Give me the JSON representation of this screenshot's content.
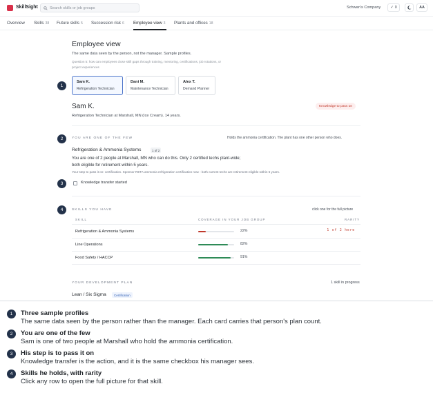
{
  "app": {
    "name": "SkillSight"
  },
  "search": {
    "placeholder": "Search skills or job groups"
  },
  "header": {
    "company": "Schwan's Company",
    "check_count": "0",
    "text_size_label": "AA"
  },
  "tabs": [
    {
      "label": "Overview",
      "count": ""
    },
    {
      "label": "Skills",
      "count": "38"
    },
    {
      "label": "Future skills",
      "count": "5"
    },
    {
      "label": "Succession risk",
      "count": "6"
    },
    {
      "label": "Employee view",
      "count": "3"
    },
    {
      "label": "Plants and offices",
      "count": "18"
    }
  ],
  "page": {
    "title": "Employee view",
    "subtitle": "The same data seen by the person, not the manager. Sample profiles.",
    "question_label": "Question 5:",
    "question_text": "how can employees close skill gaps through training, mentoring, certifications, job rotations, or project experiences"
  },
  "profiles": [
    {
      "name": "Sam K.",
      "role": "Refrigeration Technician",
      "selected": true
    },
    {
      "name": "Dani M.",
      "role": "Maintenance Technician",
      "selected": false
    },
    {
      "name": "Alex T.",
      "role": "Demand Planner",
      "selected": false
    }
  ],
  "profile": {
    "name": "Sam K.",
    "badge": "Knowledge to pass on",
    "meta": "Refrigeration Technician at Marshall, MN (Ice Cream). 14 years."
  },
  "section_one": {
    "kicker": "You are one of the few",
    "note": "Holds the ammonia certification. The plant has one other person who does.",
    "skill": "Refrigeration & Ammonia Systems",
    "skill_tag": "1 of 2",
    "paragraph": "You are one of 2 people at Marshall, MN who can do this. Only 2 certified techs plant-wide; both eligible for retirement within 5 years.",
    "detail": "Your step to pass it on: certification. Sponsor RETA ammonia refrigeration certification now - both current techs are retirement-eligible within 5 years.",
    "checkbox_label": "Knowledge transfer started",
    "checkbox_checked": false
  },
  "section_skills": {
    "kicker": "Skills you have",
    "hint": "click one for the full picture",
    "columns": {
      "skill": "Skill",
      "coverage": "Coverage in your job group",
      "rarity": "Rarity"
    },
    "rows": [
      {
        "skill": "Refrigeration & Ammonia Systems",
        "coverage_pct": 22,
        "coverage_label": "22%",
        "color": "#c0392b",
        "rarity": "1 of 2 here"
      },
      {
        "skill": "Line Operations",
        "coverage_pct": 82,
        "coverage_label": "82%",
        "color": "#2e8b57",
        "rarity": ""
      },
      {
        "skill": "Food Safety / HACCP",
        "coverage_pct": 91,
        "coverage_label": "91%",
        "color": "#2e8b57",
        "rarity": ""
      }
    ]
  },
  "section_dev": {
    "kicker": "Your development plan",
    "status": "1 skill in progress",
    "item": "Lean / Six Sigma",
    "item_tag": "Certification"
  },
  "explainer": [
    {
      "num": "1",
      "title": "Three sample profiles",
      "text": "The same data seen by the person rather than the manager. Each card carries that person's plan count."
    },
    {
      "num": "2",
      "title": "You are one of the few",
      "text": "Sam is one of two people at Marshall who hold the ammonia certification."
    },
    {
      "num": "3",
      "title": "His step is to pass it on",
      "text": "Knowledge transfer is the action, and it is the same checkbox his manager sees."
    },
    {
      "num": "4",
      "title": "Skills he holds, with rarity",
      "text": "Click any row to open the full picture for that skill."
    }
  ],
  "colors": {
    "brand": "#d9304a",
    "marker": "#23324a",
    "alert": "#c0392b",
    "ok": "#2e8b57",
    "accent": "#4a73c9"
  }
}
